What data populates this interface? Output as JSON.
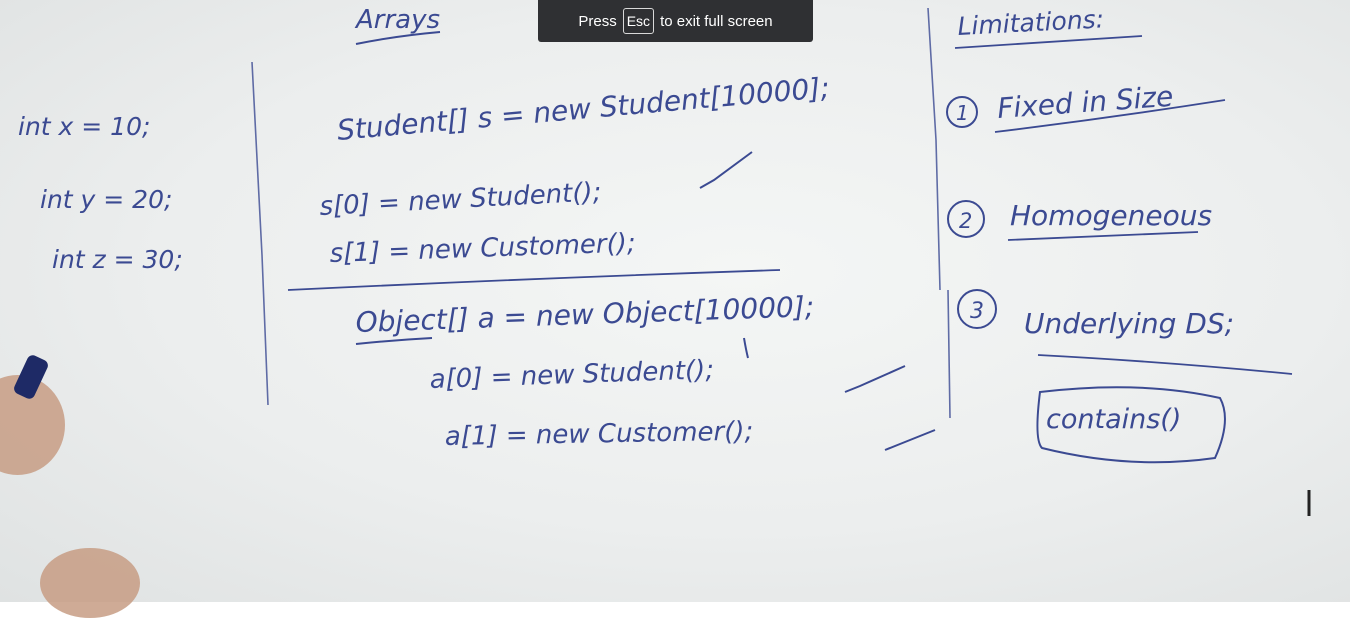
{
  "overlay": {
    "press": "Press",
    "key": "Esc",
    "suffix": "to exit full screen"
  },
  "board": {
    "title": "Arrays",
    "left_code": [
      "int x = 10;",
      "int y = 20;",
      "int z = 30;"
    ],
    "code_block_1": [
      "Student[] s = new Student[10000];",
      "s[0] = new Student();",
      "s[1] = new Customer();"
    ],
    "code_block_2": [
      "Object[] a = new Object[10000];",
      "a[0] = new Student();",
      "a[1] = new Customer();"
    ],
    "limitations": {
      "heading": "Limitations:",
      "items": [
        {
          "num": "1",
          "text": "Fixed in Size"
        },
        {
          "num": "2",
          "text": "Homogeneous"
        },
        {
          "num": "3",
          "text": "Underlying DS;"
        }
      ],
      "boxed": "contains()"
    }
  },
  "colors": {
    "ink": "#3b4a92",
    "board": "#eceeee",
    "overlay": "#2f3033"
  }
}
